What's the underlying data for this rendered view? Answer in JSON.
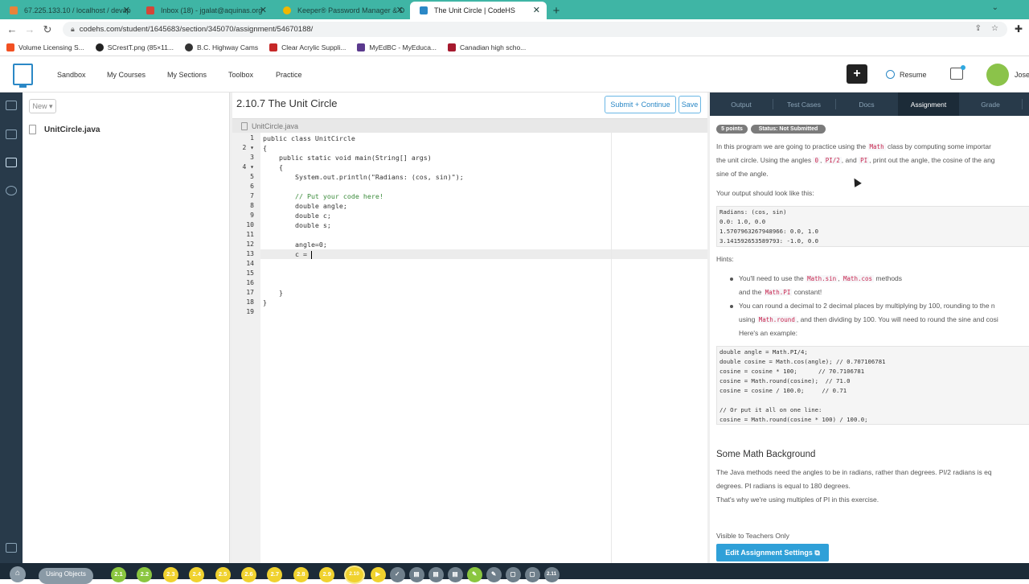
{
  "browser": {
    "tabs": [
      {
        "title": "67.225.133.10 / localhost / devap",
        "color": "#e8833a"
      },
      {
        "title": "Inbox (18) - jgalat@aquinas.org",
        "color": "#d44638"
      },
      {
        "title": "Keeper® Password Manager & D",
        "color": "#f1b700"
      },
      {
        "title": "The Unit Circle | CodeHS",
        "color": "#2b88c6"
      }
    ],
    "url": "codehs.com/student/1645683/section/345070/assignment/54670188/",
    "bookmarks": [
      {
        "label": "Volume Licensing S...",
        "color": "#f25022"
      },
      {
        "label": "SCrestT.png (85×11...",
        "color": "#222222"
      },
      {
        "label": "B.C. Highway Cams",
        "color": "#333333"
      },
      {
        "label": "Clear Acrylic Suppli...",
        "color": "#c62828"
      },
      {
        "label": "MyEdBC - MyEduca...",
        "color": "#5b3a8e"
      },
      {
        "label": "Canadian high scho...",
        "color": "#a6192e"
      }
    ]
  },
  "site_nav": {
    "links": [
      "Sandbox",
      "My Courses",
      "My Sections",
      "Toolbox",
      "Practice"
    ],
    "plus": "+",
    "resume": "Resume",
    "user": "Jose"
  },
  "files": {
    "new_label": "New ▾",
    "file_name": "UnitCircle.java"
  },
  "editor": {
    "title": "2.10.7 The Unit Circle",
    "submit_label": "Submit + Continue",
    "save_label": "Save",
    "tab_label": "UnitCircle.java",
    "current_line": 13,
    "lines": [
      {
        "n": "1",
        "text": "public class UnitCircle"
      },
      {
        "n": "2 ▾",
        "text": "{"
      },
      {
        "n": "3",
        "text": "    public static void main(String[] args)"
      },
      {
        "n": "4 ▾",
        "text": "    {"
      },
      {
        "n": "5",
        "text": "        System.out.println(\"Radians: (cos, sin)\");"
      },
      {
        "n": "6",
        "text": ""
      },
      {
        "n": "7",
        "text": "        // Put your code here!",
        "comment": true
      },
      {
        "n": "8",
        "text": "        double angle;"
      },
      {
        "n": "9",
        "text": "        double c;"
      },
      {
        "n": "10",
        "text": "        double s;"
      },
      {
        "n": "11",
        "text": ""
      },
      {
        "n": "12",
        "text": "        angle=0;"
      },
      {
        "n": "13",
        "text": "        c = "
      },
      {
        "n": "14",
        "text": ""
      },
      {
        "n": "15",
        "text": ""
      },
      {
        "n": "16",
        "text": ""
      },
      {
        "n": "17",
        "text": "    }"
      },
      {
        "n": "18",
        "text": "}"
      },
      {
        "n": "19",
        "text": ""
      }
    ]
  },
  "panel": {
    "tabs": [
      "Output",
      "Test Cases",
      "Docs",
      "Assignment",
      "Grade"
    ],
    "active_tab": "Assignment",
    "points_badge": "5 points",
    "status_badge": "Status: Not Submitted",
    "intro": {
      "p1_a": "In this program we are going to practice using the ",
      "p1_code": "Math",
      "p1_b": " class by computing some importar",
      "p2_a": "the unit circle. Using the angles ",
      "p2_c1": "0",
      "p2_sep": ", ",
      "p2_c2": "PI/2",
      "p2_and": ", and ",
      "p2_c3": "PI",
      "p2_b": ", print out the angle, the cosine of the ang",
      "p3": "sine of the angle."
    },
    "output_heading": "Your output should look like this:",
    "sample_output": "Radians: (cos, sin)\n0.0: 1.0, 0.0\n1.5707963267948966: 0.0, 1.0\n3.141592653589793: -1.0, 0.0",
    "hints_heading": "Hints:",
    "hint1": {
      "a": "You'll need to use the ",
      "c1": "Math.sin",
      "sep": ", ",
      "c2": "Math.cos",
      "b": " methods",
      "c": "and the ",
      "c3": "Math.PI",
      "d": " constant!"
    },
    "hint2": {
      "l1": "You can round a decimal to 2 decimal places by multiplying by 100, rounding to the n",
      "l2_a": "using ",
      "l2_code": "Math.round",
      "l2_b": ", and then dividing by 100. You will need to round the sine and cosi",
      "l3": "Here's an example:"
    },
    "example_code": "double angle = Math.PI/4;\ndouble cosine = Math.cos(angle); // 0.707106781\ncosine = cosine * 100;      // 70.7106781\ncosine = Math.round(cosine);  // 71.0\ncosine = cosine / 100.0;     // 0.71\n\n// Or put it all on one line:\ncosine = Math.round(cosine * 100) / 100.0;",
    "bg_heading": "Some Math Background",
    "bg_l1": "The Java methods need the angles to be in radians, rather than degrees. PI/2 radians is eq",
    "bg_l2": "degrees. PI radians is equal to 180 degrees.",
    "bg_l3": "That's why we're using multiples of PI in this exercise.",
    "teachers_only": "Visible to Teachers Only",
    "edit_settings": "Edit Assignment Settings ⧉"
  },
  "bottom_bar": {
    "lesson": "Using Objects",
    "items": [
      {
        "label": "2.1",
        "state": "done"
      },
      {
        "label": "2.2",
        "state": "done"
      },
      {
        "label": "2.3",
        "state": "todo"
      },
      {
        "label": "2.4",
        "state": "todo"
      },
      {
        "label": "2.5",
        "state": "todo"
      },
      {
        "label": "2.6",
        "state": "todo"
      },
      {
        "label": "2.7",
        "state": "todo"
      },
      {
        "label": "2.8",
        "state": "todo"
      },
      {
        "label": "2.9",
        "state": "todo"
      },
      {
        "label": "2.10",
        "state": "current"
      },
      {
        "label": "▶",
        "state": "todo"
      },
      {
        "label": "✓",
        "state": "locked"
      },
      {
        "label": "▤",
        "state": "locked"
      },
      {
        "label": "▤",
        "state": "locked"
      },
      {
        "label": "▤",
        "state": "locked"
      },
      {
        "label": "✎",
        "state": "done"
      },
      {
        "label": "✎",
        "state": "locked"
      },
      {
        "label": "▢",
        "state": "locked"
      },
      {
        "label": "▢",
        "state": "locked"
      },
      {
        "label": "2.11",
        "state": "locked"
      }
    ]
  }
}
